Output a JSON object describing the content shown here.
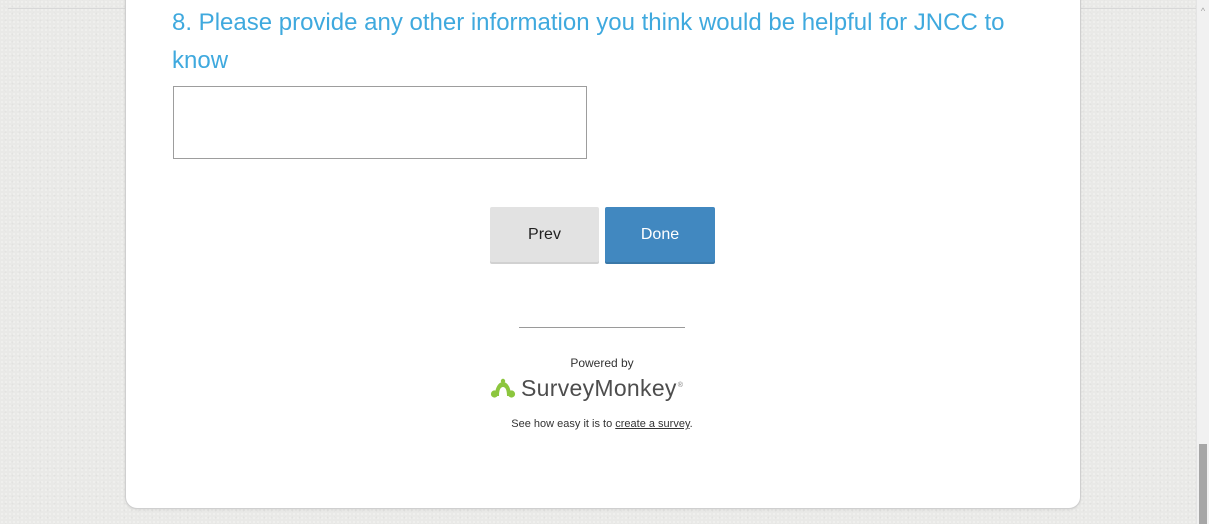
{
  "question": {
    "title": "8. Please provide any other information you think would be helpful for JNCC to know",
    "answer_value": ""
  },
  "navigation": {
    "prev_label": "Prev",
    "done_label": "Done"
  },
  "footer": {
    "powered_by": "Powered by",
    "brand_name": "SurveyMonkey",
    "brand_registered": "®",
    "tagline_prefix": "See how easy it is to ",
    "tagline_link": "create a survey",
    "tagline_suffix": "."
  },
  "scrollbar": {
    "up_arrow_glyph": "^",
    "up_arrow_icon": "chevron-up-icon"
  },
  "colors": {
    "question_title": "#3fa9de",
    "done_button": "#4188c0",
    "prev_button": "#e2e2e2",
    "logo_green": "#8cc63e",
    "background": "#e9e9e7"
  },
  "icons": {
    "logo_icon": "surveymonkey-logo-icon"
  }
}
